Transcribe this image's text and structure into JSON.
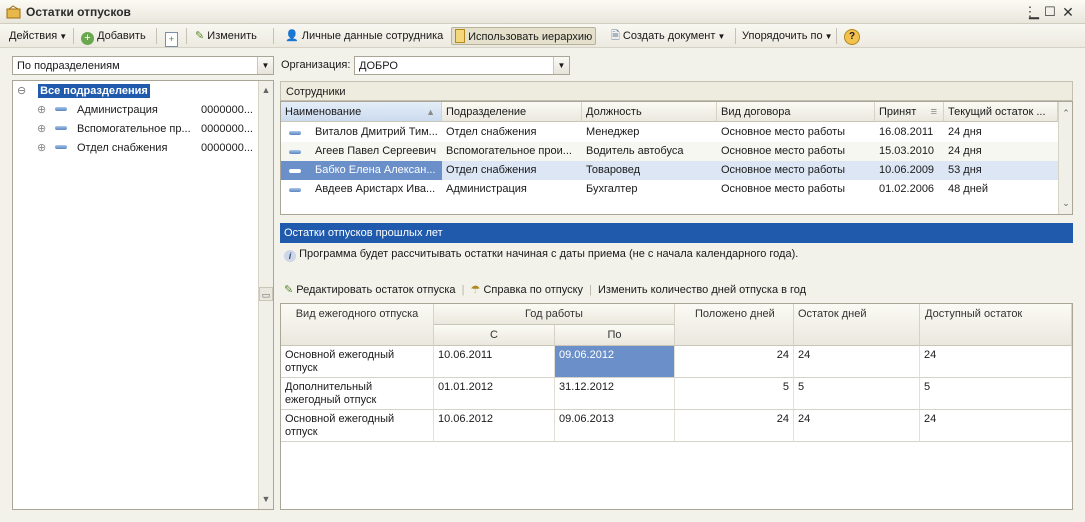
{
  "window": {
    "title": "Остатки отпусков"
  },
  "toolbar": {
    "actions": "Действия",
    "add": "Добавить",
    "edit": "Изменить",
    "personal": "Личные данные сотрудника",
    "hierarchy": "Использовать иерархию",
    "create_doc": "Создать документ",
    "sort": "Упорядочить по",
    "help": "?"
  },
  "filter": {
    "group_mode": "По подразделениям",
    "org_label": "Организация:",
    "org_value": "ДОБРО"
  },
  "tree": {
    "root": "Все подразделения",
    "items": [
      {
        "name": "Администрация",
        "code": "0000000..."
      },
      {
        "name": "Вспомогательное пр...",
        "code": "0000000..."
      },
      {
        "name": "Отдел снабжения",
        "code": "0000000..."
      }
    ]
  },
  "employees": {
    "group_title": "Сотрудники",
    "columns": [
      "Наименование",
      "Подразделение",
      "Должность",
      "Вид договора",
      "Принят",
      "Текущий остаток ..."
    ],
    "rows": [
      [
        "Виталов Дмитрий Тим...",
        "Отдел снабжения",
        "Менеджер",
        "Основное место работы",
        "16.08.2011",
        "24 дня"
      ],
      [
        "Агеев Павел Сергеевич",
        "Вспомогательное прои...",
        "Водитель автобуса",
        "Основное место работы",
        "15.03.2010",
        "24 дня"
      ],
      [
        "Бабко Елена Алексан...",
        "Отдел снабжения",
        "Товаровед",
        "Основное место работы",
        "10.06.2009",
        "53 дня"
      ],
      [
        "Авдеев Аристарх Ива...",
        "Администрация",
        "Бухгалтер",
        "Основное место работы",
        "01.02.2006",
        "48 дней"
      ]
    ]
  },
  "past_leaves": {
    "title": "Остатки отпусков прошлых лет",
    "info": "Программа будет рассчитывать остатки начиная с даты приема (не с начала календарного года).",
    "actions": {
      "edit": "Редактировать остаток отпуска",
      "help": "Справка по отпуску",
      "change_days": "Изменить количество дней отпуска в год"
    },
    "columns": {
      "type": "Вид ежегодного отпуска",
      "work_year": "Год работы",
      "from": "С",
      "to": "По",
      "entitled": "Положено дней",
      "balance": "Остаток дней",
      "available": "Доступный остаток"
    },
    "rows": [
      {
        "type": "Основной ежегодный отпуск",
        "from": "10.06.2011",
        "to": "09.06.2012",
        "entitled": "24",
        "balance": "24",
        "available": "24"
      },
      {
        "type": "Дополнительный ежегодный отпуск",
        "from": "01.01.2012",
        "to": "31.12.2012",
        "entitled": "5",
        "balance": "5",
        "available": "5"
      },
      {
        "type": "Основной ежегодный отпуск",
        "from": "10.06.2012",
        "to": "09.06.2013",
        "entitled": "24",
        "balance": "24",
        "available": "24"
      }
    ]
  },
  "colors": {
    "selection": "#1f5aad",
    "cell_selected": "#6b8fc9",
    "row_selected": "#dce6f4"
  }
}
